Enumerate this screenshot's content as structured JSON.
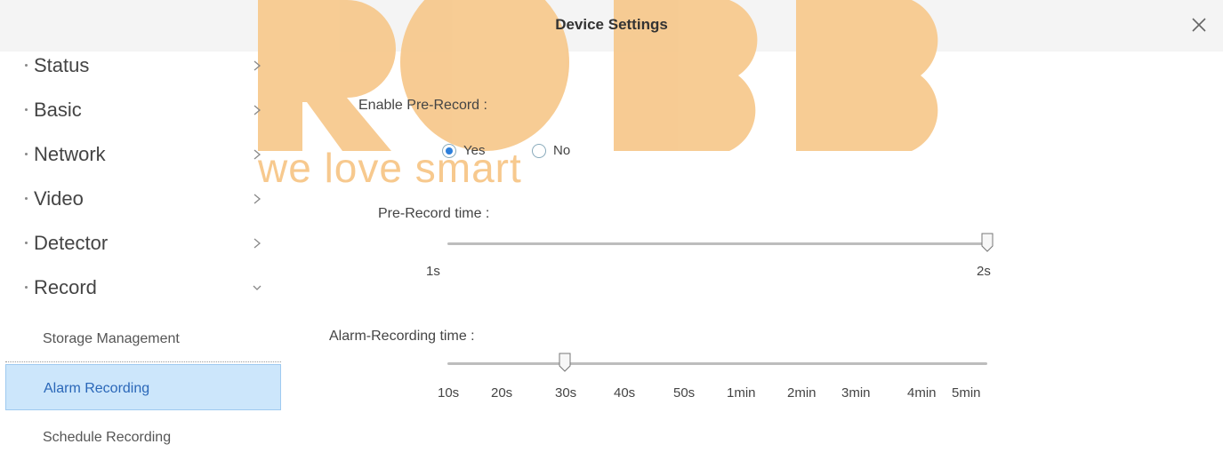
{
  "dialog": {
    "title": "Device Settings"
  },
  "watermark": {
    "text": "we love smart",
    "color": "#f7c98e"
  },
  "sidebar": {
    "items": [
      {
        "label": "Status",
        "expanded": false
      },
      {
        "label": "Basic",
        "expanded": false
      },
      {
        "label": "Network",
        "expanded": false
      },
      {
        "label": "Video",
        "expanded": false
      },
      {
        "label": "Detector",
        "expanded": false
      },
      {
        "label": "Record",
        "expanded": true
      }
    ],
    "subitems": [
      {
        "label": "Storage Management",
        "active": false
      },
      {
        "label": "Alarm Recording",
        "active": true
      },
      {
        "label": "Schedule Recording",
        "active": false
      }
    ]
  },
  "form": {
    "enable_prerecord": {
      "label": "Enable Pre-Record :",
      "options": [
        "Yes",
        "No"
      ],
      "selected": "Yes"
    },
    "prerecord_time": {
      "label": "Pre-Record time :",
      "ticks": [
        "1s",
        "2s"
      ],
      "value": "2s"
    },
    "alarm_recording_time": {
      "label": "Alarm-Recording time :",
      "ticks": [
        "10s",
        "20s",
        "30s",
        "40s",
        "50s",
        "1min",
        "2min",
        "3min",
        "4min",
        "5min"
      ],
      "value": "30s"
    }
  },
  "colors": {
    "accent": "#2d7fdb",
    "active_bg": "#cce6fb",
    "titlebar_bg": "#f4f4f4"
  }
}
